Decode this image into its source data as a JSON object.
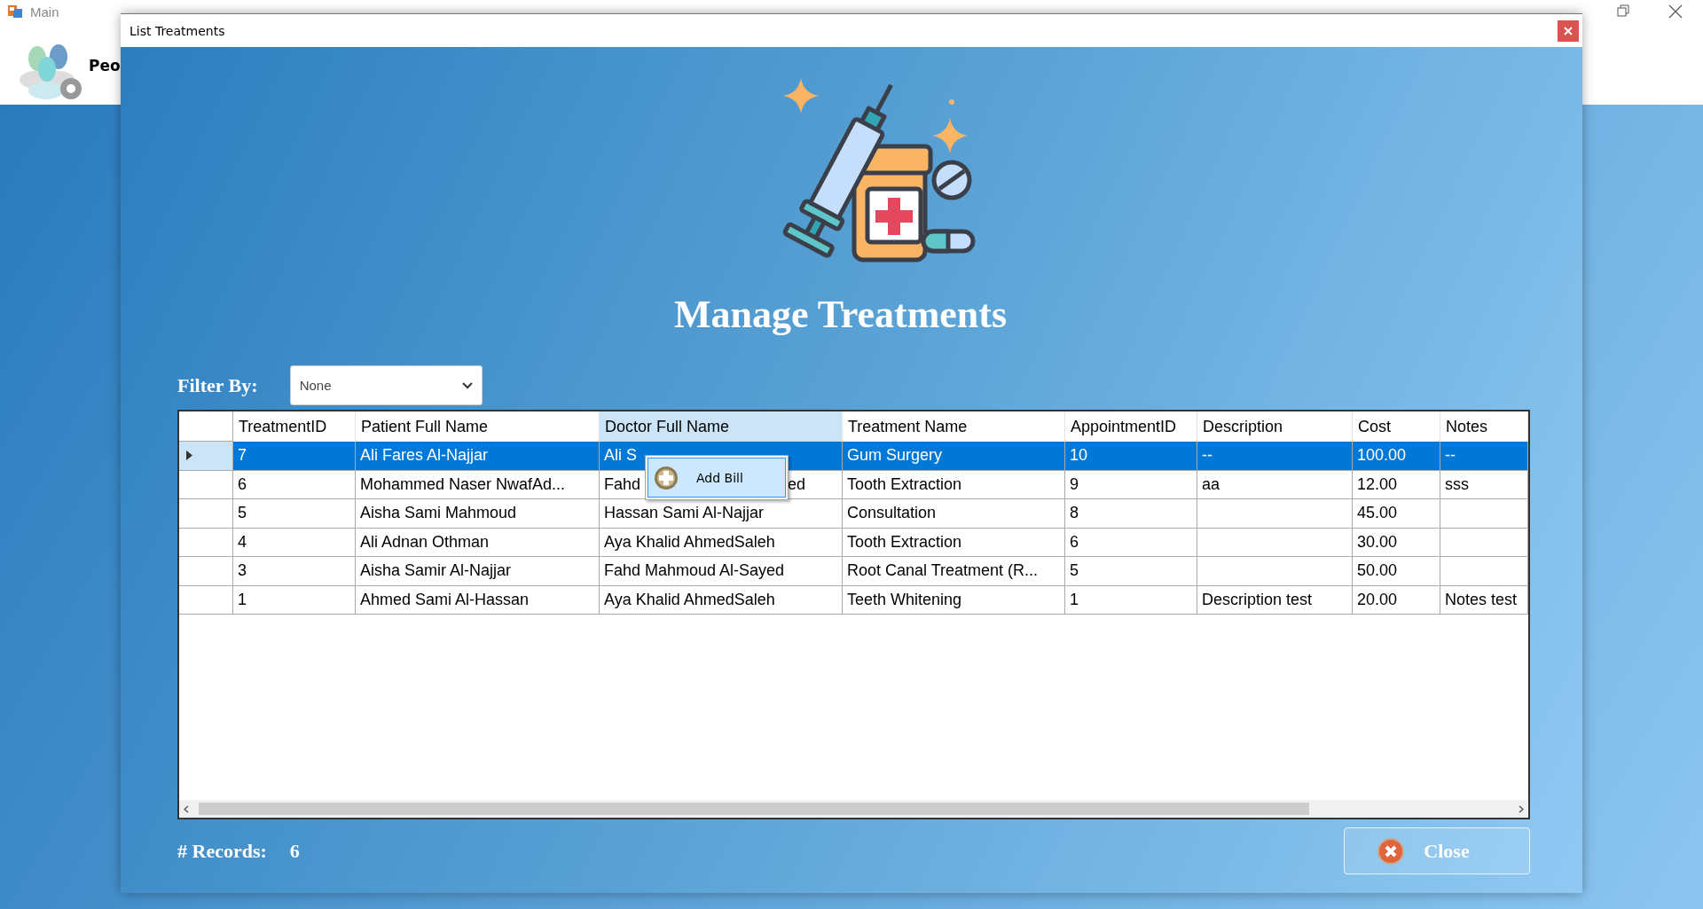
{
  "main_window": {
    "title": "Main",
    "header_label": "Peo"
  },
  "dialog": {
    "title": "List Treatments",
    "heading": "Manage Treatments",
    "filter": {
      "label": "Filter By:",
      "value": "None"
    },
    "table": {
      "columns": [
        {
          "label": "TreatmentID",
          "highlighted": false
        },
        {
          "label": "Patient Full Name",
          "highlighted": false
        },
        {
          "label": "Doctor Full Name",
          "highlighted": true
        },
        {
          "label": "Treatment Name",
          "highlighted": false
        },
        {
          "label": "AppointmentID",
          "highlighted": false
        },
        {
          "label": "Description",
          "highlighted": false
        },
        {
          "label": "Cost",
          "highlighted": false
        },
        {
          "label": "Notes",
          "highlighted": false
        }
      ],
      "rows": [
        {
          "selected": true,
          "cells": [
            "7",
            "Ali Fares Al-Najjar",
            "Ali S",
            "Gum Surgery",
            "10",
            "--",
            "100.00",
            "--"
          ]
        },
        {
          "selected": false,
          "cells": [
            "6",
            "Mohammed Naser NwafAd...",
            "Fahd",
            "Tooth Extraction",
            "9",
            "aa",
            "12.00",
            "sss"
          ],
          "doctor_tail": "ed"
        },
        {
          "selected": false,
          "cells": [
            "5",
            "Aisha Sami Mahmoud",
            "Hassan Sami Al-Najjar",
            "Consultation",
            "8",
            "",
            "45.00",
            ""
          ]
        },
        {
          "selected": false,
          "cells": [
            "4",
            "Ali Adnan Othman",
            "Aya Khalid AhmedSaleh",
            "Tooth Extraction",
            "6",
            "",
            "30.00",
            ""
          ]
        },
        {
          "selected": false,
          "cells": [
            "3",
            "Aisha Samir Al-Najjar",
            "Fahd Mahmoud Al-Sayed",
            "Root Canal Treatment (R...",
            "5",
            "",
            "50.00",
            ""
          ]
        },
        {
          "selected": false,
          "cells": [
            "1",
            "Ahmed Sami Al-Hassan",
            "Aya Khalid AhmedSaleh",
            "Teeth Whitening",
            "1",
            "Description test",
            "20.00",
            "Notes test"
          ]
        }
      ]
    },
    "context_menu": {
      "items": [
        {
          "label": "Add Bill"
        }
      ]
    },
    "records": {
      "label": "# Records:",
      "value": "6"
    },
    "close_button": "Close"
  }
}
